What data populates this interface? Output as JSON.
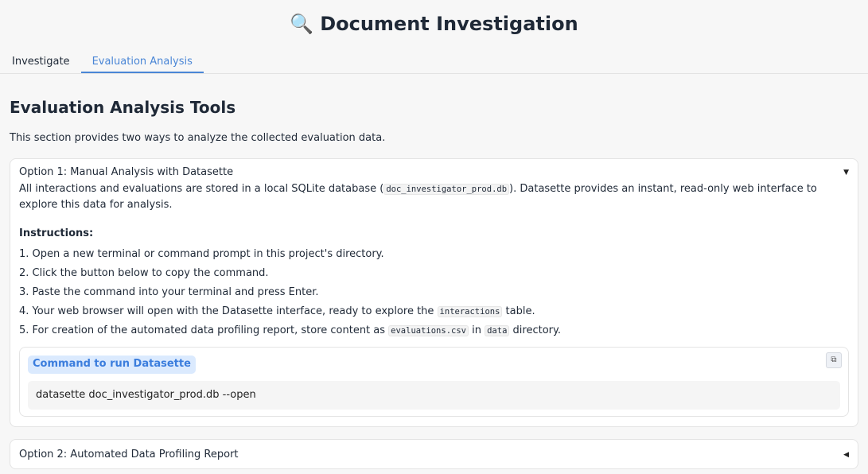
{
  "header": {
    "icon": "🔍",
    "title": "Document Investigation"
  },
  "tabs": [
    {
      "label": "Investigate",
      "active": false
    },
    {
      "label": "Evaluation Analysis",
      "active": true
    }
  ],
  "main": {
    "heading": "Evaluation Analysis Tools",
    "intro": "This section provides two ways to analyze the collected evaluation data."
  },
  "option1": {
    "title": "Option 1: Manual Analysis with Datasette",
    "caret": "▼",
    "desc_before": "All interactions and evaluations are stored in a local SQLite database (",
    "db_name": "doc_investigator_prod.db",
    "desc_after": "). Datasette provides an instant, read-only web interface to explore this data for analysis.",
    "instructions_heading": "Instructions:",
    "steps": [
      "1. Open a new terminal or command prompt in this project's directory.",
      "2. Click the button below to copy the command.",
      "3. Paste the command into your terminal and press Enter."
    ],
    "step4_before": "4. Your web browser will open with the Datasette interface, ready to explore the ",
    "step4_code": "interactions",
    "step4_after": " table.",
    "step5_before": "5. For creation of the automated data profiling report, store content as ",
    "step5_code1": "evaluations.csv",
    "step5_mid": " in ",
    "step5_code2": "data",
    "step5_after": " directory.",
    "command_label": "Command to run Datasette",
    "command": "datasette doc_investigator_prod.db --open"
  },
  "option2": {
    "title": "Option 2: Automated Data Profiling Report",
    "caret": "◀"
  },
  "icons": {
    "title": "magnifier-icon",
    "copy": "copy-icon"
  }
}
